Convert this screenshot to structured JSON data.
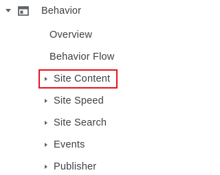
{
  "section": {
    "label": "Behavior",
    "caret_icon": "caret-down-icon",
    "icon": "window-icon"
  },
  "items": [
    {
      "label": "Overview",
      "has_arrow": false
    },
    {
      "label": "Behavior Flow",
      "has_arrow": false
    },
    {
      "label": "Site Content",
      "has_arrow": true,
      "highlighted": true
    },
    {
      "label": "Site Speed",
      "has_arrow": true
    },
    {
      "label": "Site Search",
      "has_arrow": true
    },
    {
      "label": "Events",
      "has_arrow": true
    },
    {
      "label": "Publisher",
      "has_arrow": true
    }
  ],
  "colors": {
    "text": "#3c4043",
    "icon": "#5f6368",
    "highlight": "#e8131b"
  }
}
